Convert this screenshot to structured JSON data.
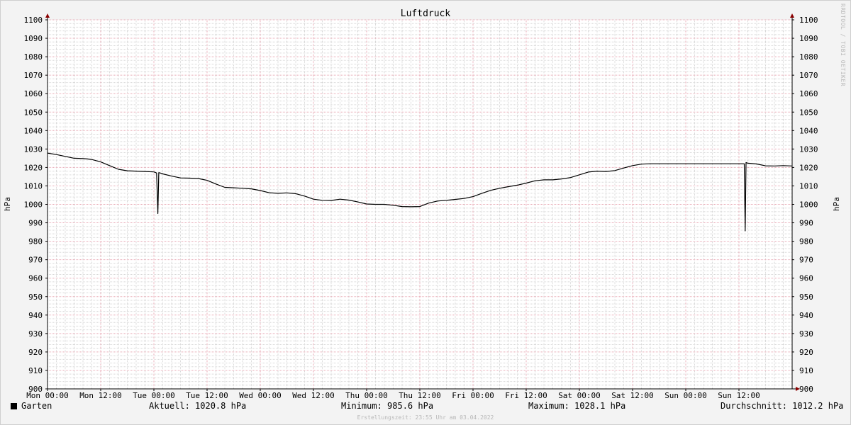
{
  "watermark": "RRDTOOL / TOBI OETIKER",
  "footer": "Erstellungszeit: 23:55 Uhr am 03.04.2022",
  "legend": {
    "series_name": "Garten",
    "current": "Aktuell: 1020.8 hPa",
    "minimum": "Minimum: 985.6 hPa",
    "maximum": "Maximum: 1028.1 hPa",
    "average": "Durchschnitt: 1012.2 hPa"
  },
  "colors": {
    "line": "#000000",
    "minor_grid": "#d7d7d7",
    "major_grid": "#e8a8b4",
    "axis_arrow": "#8b0000"
  },
  "chart_data": {
    "type": "line",
    "title": "Luftdruck",
    "ylabel": "hPa",
    "ylim": [
      900,
      1100
    ],
    "xlim": [
      0,
      168
    ],
    "grid": true,
    "x_tick_labels": [
      "Mon 00:00",
      "Mon 12:00",
      "Tue 00:00",
      "Tue 12:00",
      "Wed 00:00",
      "Wed 12:00",
      "Thu 00:00",
      "Thu 12:00",
      "Fri 00:00",
      "Fri 12:00",
      "Sat 00:00",
      "Sat 12:00",
      "Sun 00:00",
      "Sun 12:00"
    ],
    "x_tick_hours": [
      0,
      12,
      24,
      36,
      48,
      60,
      72,
      84,
      96,
      108,
      120,
      132,
      144,
      156
    ],
    "y_ticks": [
      900,
      910,
      920,
      930,
      940,
      950,
      960,
      970,
      980,
      990,
      1000,
      1010,
      1020,
      1030,
      1040,
      1050,
      1060,
      1070,
      1080,
      1090,
      1100
    ],
    "series": [
      {
        "name": "Garten",
        "x_hours": [
          0,
          2,
          4,
          6,
          8,
          9,
          10,
          12,
          14,
          16,
          18,
          20,
          22,
          24,
          24.6,
          24.9,
          25.1,
          25.4,
          26,
          28,
          30,
          32,
          34,
          36,
          38,
          40,
          42,
          44,
          46,
          48,
          50,
          52,
          54,
          56,
          58,
          60,
          62,
          64,
          66,
          68,
          70,
          72,
          74,
          76,
          78,
          80,
          82,
          84,
          86,
          88,
          90,
          92,
          94,
          96,
          98,
          100,
          102,
          104,
          106,
          108,
          110,
          112,
          114,
          116,
          118,
          120,
          122,
          124,
          126,
          128,
          130,
          132,
          134,
          136,
          138,
          140,
          142,
          144,
          146,
          148,
          150,
          152,
          154,
          156,
          157.2,
          157.4,
          157.6,
          158,
          160,
          162,
          164,
          166,
          168
        ],
        "values": [
          1027.8,
          1027,
          1026,
          1025,
          1024.8,
          1024.6,
          1024.3,
          1023,
          1021,
          1019,
          1018.2,
          1018,
          1017.8,
          1017.6,
          1017,
          995,
          1017.2,
          1017,
          1016.5,
          1015.3,
          1014.3,
          1014.2,
          1014,
          1013,
          1011,
          1009.2,
          1009,
          1008.7,
          1008.4,
          1007.5,
          1006.3,
          1006,
          1006.2,
          1005.8,
          1004.5,
          1002.8,
          1002.2,
          1002.1,
          1002.8,
          1002.3,
          1001.3,
          1000.2,
          1000,
          1000,
          999.5,
          998.8,
          998.7,
          998.8,
          1000.7,
          1001.8,
          1002.2,
          1002.7,
          1003.2,
          1004.2,
          1006,
          1007.6,
          1008.7,
          1009.6,
          1010.4,
          1011.5,
          1012.8,
          1013.3,
          1013.3,
          1013.8,
          1014.5,
          1016,
          1017.5,
          1018,
          1017.8,
          1018.3,
          1019.7,
          1021,
          1021.8,
          1022,
          1022,
          1022,
          1022,
          1022,
          1022,
          1022,
          1022,
          1022,
          1022,
          1022,
          1022,
          985.6,
          1022.7,
          1022.3,
          1021.9,
          1020.9,
          1020.8,
          1021,
          1020.8
        ]
      }
    ]
  }
}
